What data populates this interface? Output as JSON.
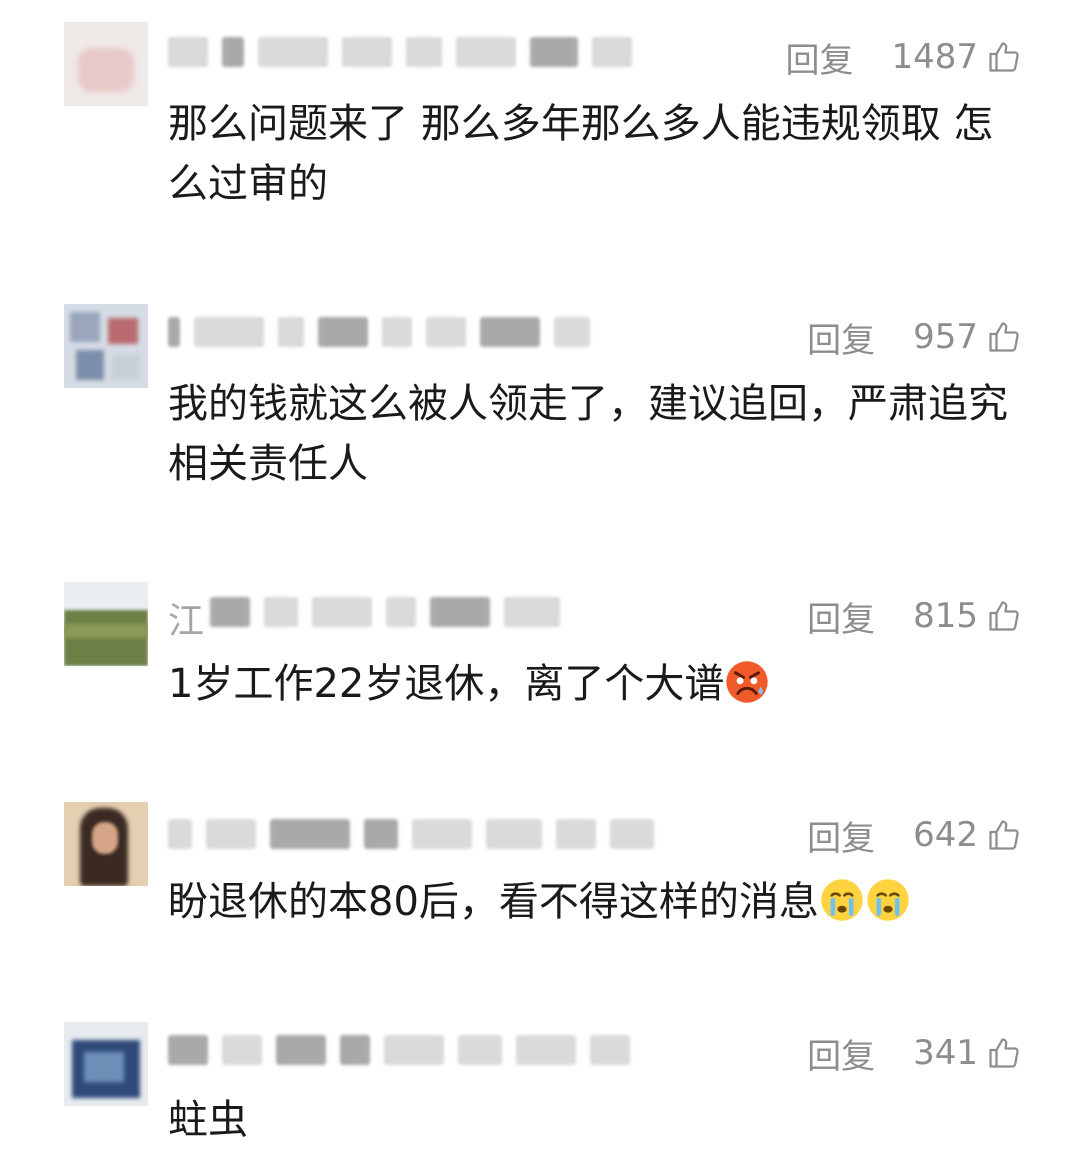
{
  "comments": [
    {
      "reply_label": "回复",
      "likes": "1487",
      "text": "那么问题来了 那么多年那么多人能违规领取 怎么过审的"
    },
    {
      "reply_label": "回复",
      "likes": "957",
      "text": "我的钱就这么被人领走了，建议追回，严肃追究相关责任人"
    },
    {
      "reply_label": "回复",
      "likes": "815",
      "username_visible": "江",
      "text": "1岁工作22岁退休，离了个大谱"
    },
    {
      "reply_label": "回复",
      "likes": "642",
      "text": "盼退休的本80后，看不得这样的消息"
    },
    {
      "reply_label": "回复",
      "likes": "341",
      "text": "蛀虫"
    }
  ],
  "icons": {
    "like": "thumbs-up-icon",
    "emoji_angry": "angry-sweat-emoji",
    "emoji_cry": "crying-emoji"
  },
  "colors": {
    "meta_text": "#8d8d8d",
    "body_text": "#1a1a1a"
  }
}
